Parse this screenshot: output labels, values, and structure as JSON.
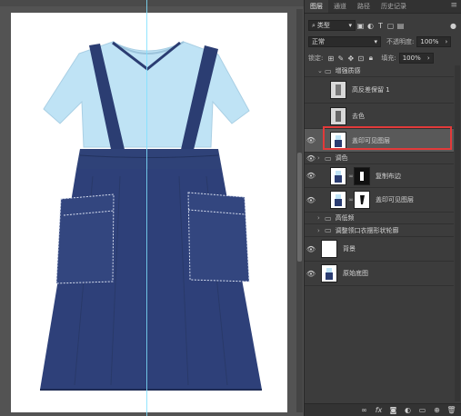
{
  "panel": {
    "tabs": [
      "图层",
      "通道",
      "路径",
      "历史记录"
    ],
    "menu_icon": "menu-icon"
  },
  "filter": {
    "kind": "类型",
    "search_icon": "search-icon"
  },
  "blend": {
    "mode": "正常",
    "opacity_label": "不透明度:",
    "opacity_value": "100%"
  },
  "lock": {
    "label": "锁定:",
    "fill_label": "填充:",
    "fill_value": "100%"
  },
  "layers": [
    {
      "name": "增强质感",
      "type": "group",
      "visible": false,
      "expanded": true
    },
    {
      "name": "高反差保留 1",
      "type": "layer",
      "visible": false
    },
    {
      "name": "去色",
      "type": "layer",
      "visible": false
    },
    {
      "name": "盖印可见图层",
      "type": "layer",
      "visible": true,
      "selected": true
    },
    {
      "name": "调色",
      "type": "group",
      "visible": true,
      "expanded": false
    },
    {
      "name": "复制布边",
      "type": "masked",
      "visible": true
    },
    {
      "name": "盖印可见图层",
      "type": "masked",
      "visible": true
    },
    {
      "name": "高低频",
      "type": "group",
      "visible": false,
      "expanded": false
    },
    {
      "name": "调整领口衣摆形状轮廓",
      "type": "group",
      "visible": false,
      "expanded": false
    },
    {
      "name": "背景",
      "type": "layer",
      "visible": true,
      "white": true
    },
    {
      "name": "原始底图",
      "type": "layer",
      "visible": true
    }
  ],
  "bottom_icons": [
    "link-icon",
    "fx-icon",
    "mask-icon",
    "adjustment-icon",
    "folder-icon",
    "new-layer-icon",
    "trash-icon"
  ],
  "colors": {
    "accent": "#e23a3a",
    "guide": "#7fe0ff",
    "shirt": "#bfe3f5",
    "skirt": "#2b3d72"
  }
}
